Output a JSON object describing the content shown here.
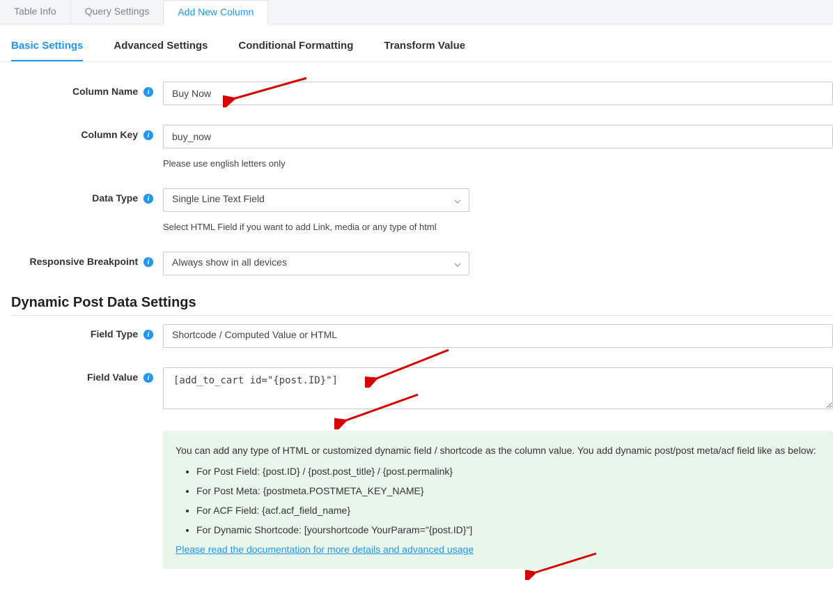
{
  "top_tabs": {
    "table_info": "Table Info",
    "query_settings": "Query Settings",
    "add_new_column": "Add New Column"
  },
  "sub_tabs": {
    "basic": "Basic Settings",
    "advanced": "Advanced Settings",
    "conditional": "Conditional Formatting",
    "transform": "Transform Value"
  },
  "labels": {
    "column_name": "Column Name",
    "column_key": "Column Key",
    "data_type": "Data Type",
    "responsive": "Responsive Breakpoint",
    "field_type": "Field Type",
    "field_value": "Field Value"
  },
  "values": {
    "column_name": "Buy Now",
    "column_key": "buy_now",
    "data_type": "Single Line Text Field",
    "responsive": "Always show in all devices",
    "field_type": "Shortcode / Computed Value or HTML",
    "field_value": "[add_to_cart id=\"{post.ID}\"]"
  },
  "helpers": {
    "column_key": "Please use english letters only",
    "data_type": "Select HTML Field if you want to add Link, media or any type of html"
  },
  "section_heading": "Dynamic Post Data Settings",
  "info_panel": {
    "lead": "You can add any type of HTML or customized dynamic field / shortcode as the column value. You add dynamic post/post meta/acf field like as below:",
    "items": [
      "For Post Field: {post.ID} / {post.post_title} / {post.permalink}",
      "For Post Meta: {postmeta.POSTMETA_KEY_NAME}",
      "For ACF Field: {acf.acf_field_name}",
      "For Dynamic Shortcode: [yourshortcode YourParam=\"{post.ID}\"]"
    ],
    "link": "Please read the documentation for more details and advanced usage"
  }
}
